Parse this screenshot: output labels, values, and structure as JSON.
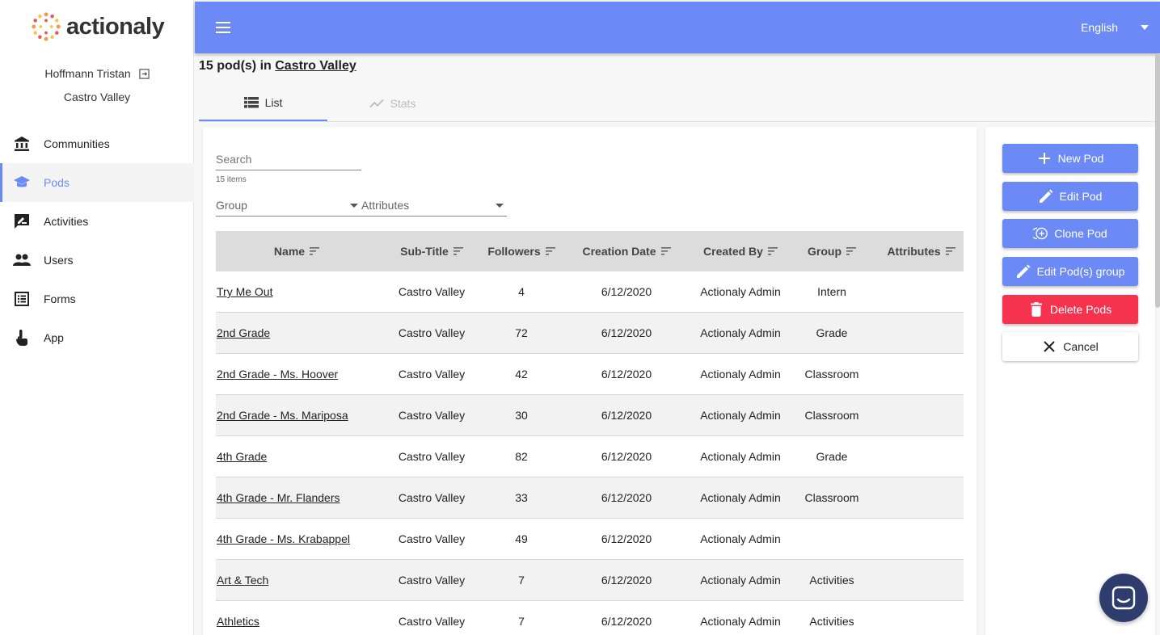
{
  "app": {
    "brand": "actionaly",
    "user_name": "Hoffmann Tristan",
    "community": "Castro Valley",
    "language": "English"
  },
  "sidebar": {
    "items": [
      {
        "label": "Communities",
        "icon": "bank-icon",
        "active": false
      },
      {
        "label": "Pods",
        "icon": "school-icon",
        "active": true
      },
      {
        "label": "Activities",
        "icon": "rate-review-icon",
        "active": false
      },
      {
        "label": "Users",
        "icon": "people-icon",
        "active": false
      },
      {
        "label": "Forms",
        "icon": "list-icon",
        "active": false
      },
      {
        "label": "App",
        "icon": "touch-icon",
        "active": false
      }
    ]
  },
  "heading": {
    "prefix": "15 pod(s) in ",
    "community_link": "Castro Valley"
  },
  "tabs": [
    {
      "label": "List",
      "icon": "list-view-icon",
      "active": true
    },
    {
      "label": "Stats",
      "icon": "trending-up-icon",
      "active": false
    }
  ],
  "filters": {
    "search_placeholder": "Search",
    "items_count": "15 items",
    "group_label": "Group",
    "attributes_label": "Attributes"
  },
  "table": {
    "columns": [
      "Name",
      "Sub-Title",
      "Followers",
      "Creation Date",
      "Created By",
      "Group",
      "Attributes"
    ],
    "rows": [
      {
        "name": "Try Me Out",
        "subtitle": "Castro Valley",
        "followers": "4",
        "date": "6/12/2020",
        "created_by": "Actionaly Admin",
        "group": "Intern",
        "attributes": ""
      },
      {
        "name": "2nd Grade",
        "subtitle": "Castro Valley",
        "followers": "72",
        "date": "6/12/2020",
        "created_by": "Actionaly Admin",
        "group": "Grade",
        "attributes": ""
      },
      {
        "name": "2nd Grade - Ms. Hoover",
        "subtitle": "Castro Valley",
        "followers": "42",
        "date": "6/12/2020",
        "created_by": "Actionaly Admin",
        "group": "Classroom",
        "attributes": ""
      },
      {
        "name": "2nd Grade - Ms. Mariposa",
        "subtitle": "Castro Valley",
        "followers": "30",
        "date": "6/12/2020",
        "created_by": "Actionaly Admin",
        "group": "Classroom",
        "attributes": ""
      },
      {
        "name": "4th Grade",
        "subtitle": "Castro Valley",
        "followers": "82",
        "date": "6/12/2020",
        "created_by": "Actionaly Admin",
        "group": "Grade",
        "attributes": ""
      },
      {
        "name": "4th Grade - Mr. Flanders",
        "subtitle": "Castro Valley",
        "followers": "33",
        "date": "6/12/2020",
        "created_by": "Actionaly Admin",
        "group": "Classroom",
        "attributes": ""
      },
      {
        "name": "4th Grade - Ms. Krabappel",
        "subtitle": "Castro Valley",
        "followers": "49",
        "date": "6/12/2020",
        "created_by": "Actionaly Admin",
        "group": "",
        "attributes": ""
      },
      {
        "name": "Art & Tech",
        "subtitle": "Castro Valley",
        "followers": "7",
        "date": "6/12/2020",
        "created_by": "Actionaly Admin",
        "group": "Activities",
        "attributes": ""
      },
      {
        "name": "Athletics",
        "subtitle": "Castro Valley",
        "followers": "7",
        "date": "6/12/2020",
        "created_by": "Actionaly Admin",
        "group": "Activities",
        "attributes": ""
      }
    ]
  },
  "actions": {
    "new_pod": "New Pod",
    "edit_pod": "Edit Pod",
    "clone_pod": "Clone Pod",
    "edit_group": "Edit Pod(s) group",
    "delete_pods": "Delete Pods",
    "cancel": "Cancel"
  },
  "colors": {
    "primary": "#6b8af6",
    "danger": "#f5334f",
    "chat": "#2f3d6e"
  }
}
